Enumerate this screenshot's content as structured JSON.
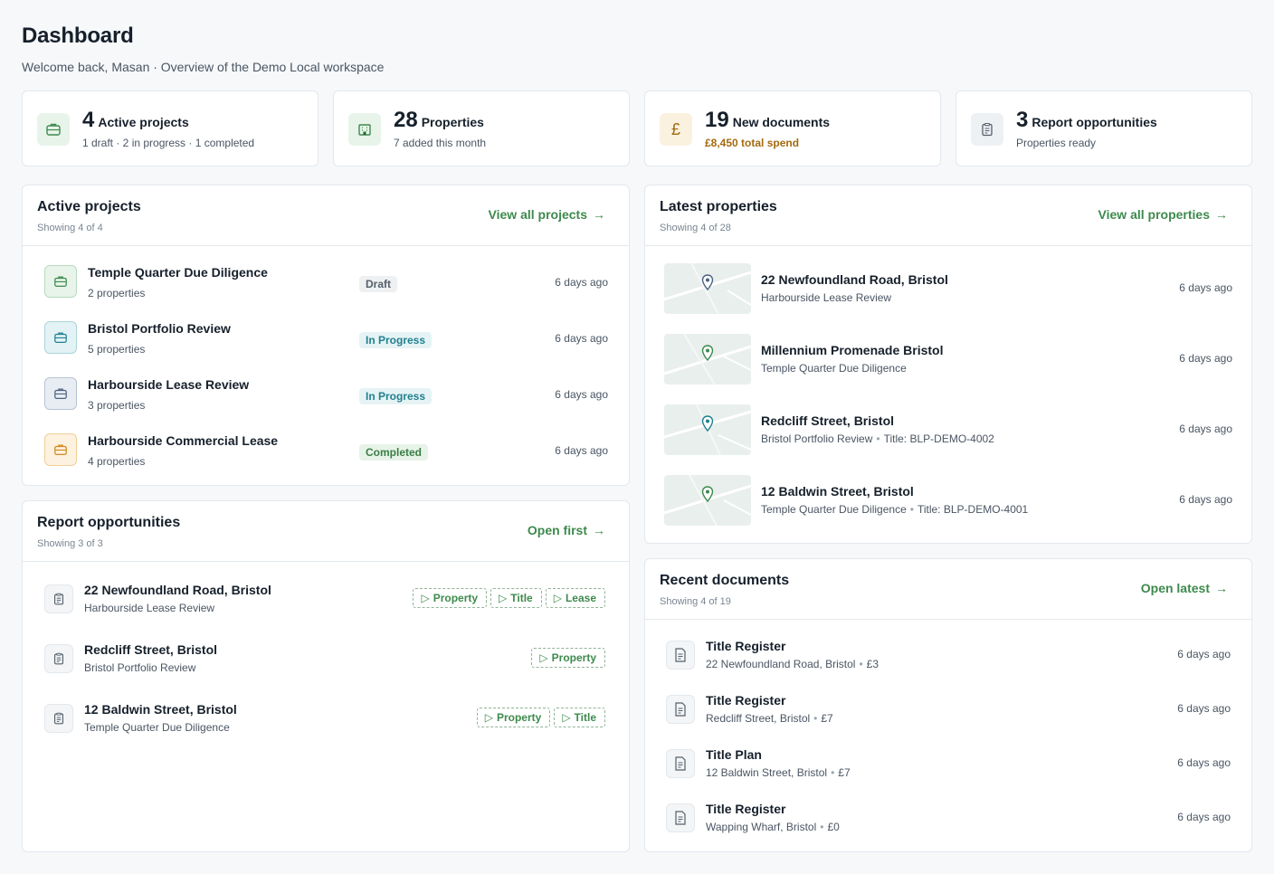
{
  "header": {
    "title": "Dashboard",
    "subtitle": "Welcome back, Masan · Overview of the Demo Local workspace"
  },
  "stats": [
    {
      "number": "4",
      "label": "Active projects",
      "sub": "1 draft · 2 in progress · 1 completed",
      "icon": "briefcase-icon"
    },
    {
      "number": "28",
      "label": "Properties",
      "sub": "7 added this month",
      "icon": "building-icon"
    },
    {
      "number": "19",
      "label": "New documents",
      "sub": "£8,450 total spend",
      "icon": "pound-icon",
      "glyph": "£"
    },
    {
      "number": "3",
      "label": "Report opportunities",
      "sub": "Properties ready",
      "icon": "clipboard-icon"
    }
  ],
  "active_projects": {
    "title": "Active projects",
    "showing": "Showing 4 of 4",
    "link": "View all projects",
    "items": [
      {
        "name": "Temple Quarter Due Diligence",
        "count": "2 properties",
        "status": "Draft",
        "date": "6 days ago"
      },
      {
        "name": "Bristol Portfolio Review",
        "count": "5 properties",
        "status": "In Progress",
        "date": "6 days ago"
      },
      {
        "name": "Harbourside Lease Review",
        "count": "3 properties",
        "status": "In Progress",
        "date": "6 days ago"
      },
      {
        "name": "Harbourside Commercial Lease",
        "count": "4 properties",
        "status": "Completed",
        "date": "6 days ago"
      }
    ]
  },
  "report_opportunities": {
    "title": "Report opportunities",
    "showing": "Showing 3 of 3",
    "link": "Open first",
    "items": [
      {
        "name": "22 Newfoundland Road, Bristol",
        "project": "Harbourside Lease Review",
        "chips": [
          "Property",
          "Title",
          "Lease"
        ]
      },
      {
        "name": "Redcliff Street, Bristol",
        "project": "Bristol Portfolio Review",
        "chips": [
          "Property"
        ]
      },
      {
        "name": "12 Baldwin Street, Bristol",
        "project": "Temple Quarter Due Diligence",
        "chips": [
          "Property",
          "Title"
        ]
      }
    ]
  },
  "latest_properties": {
    "title": "Latest properties",
    "showing": "Showing 4 of 28",
    "link": "View all properties",
    "items": [
      {
        "name": "22 Newfoundland Road, Bristol",
        "project": "Harbourside Lease Review",
        "title_no": "",
        "date": "6 days ago"
      },
      {
        "name": "Millennium Promenade Bristol",
        "project": "Temple Quarter Due Diligence",
        "title_no": "",
        "date": "6 days ago"
      },
      {
        "name": "Redcliff Street, Bristol",
        "project": "Bristol Portfolio Review",
        "title_no": "Title: BLP-DEMO-4002",
        "date": "6 days ago"
      },
      {
        "name": "12 Baldwin Street, Bristol",
        "project": "Temple Quarter Due Diligence",
        "title_no": "Title: BLP-DEMO-4001",
        "date": "6 days ago"
      }
    ]
  },
  "recent_documents": {
    "title": "Recent documents",
    "showing": "Showing 4 of 19",
    "link": "Open latest",
    "items": [
      {
        "name": "Title Register",
        "property": "22 Newfoundland Road, Bristol",
        "cost": "£3",
        "date": "6 days ago"
      },
      {
        "name": "Title Register",
        "property": "Redcliff Street, Bristol",
        "cost": "£7",
        "date": "6 days ago"
      },
      {
        "name": "Title Plan",
        "property": "12 Baldwin Street, Bristol",
        "cost": "£7",
        "date": "6 days ago"
      },
      {
        "name": "Title Register",
        "property": "Wapping Wharf, Bristol",
        "cost": "£0",
        "date": "6 days ago"
      }
    ]
  },
  "colors": {
    "accent": "#3e8a4d",
    "draft_icon": "#e6f3e8",
    "progress_icon": "#e3f2f4",
    "review_icon": "#e8edf4",
    "completed_icon": "#fdf1e0",
    "spend_text": "#a36a0f"
  }
}
